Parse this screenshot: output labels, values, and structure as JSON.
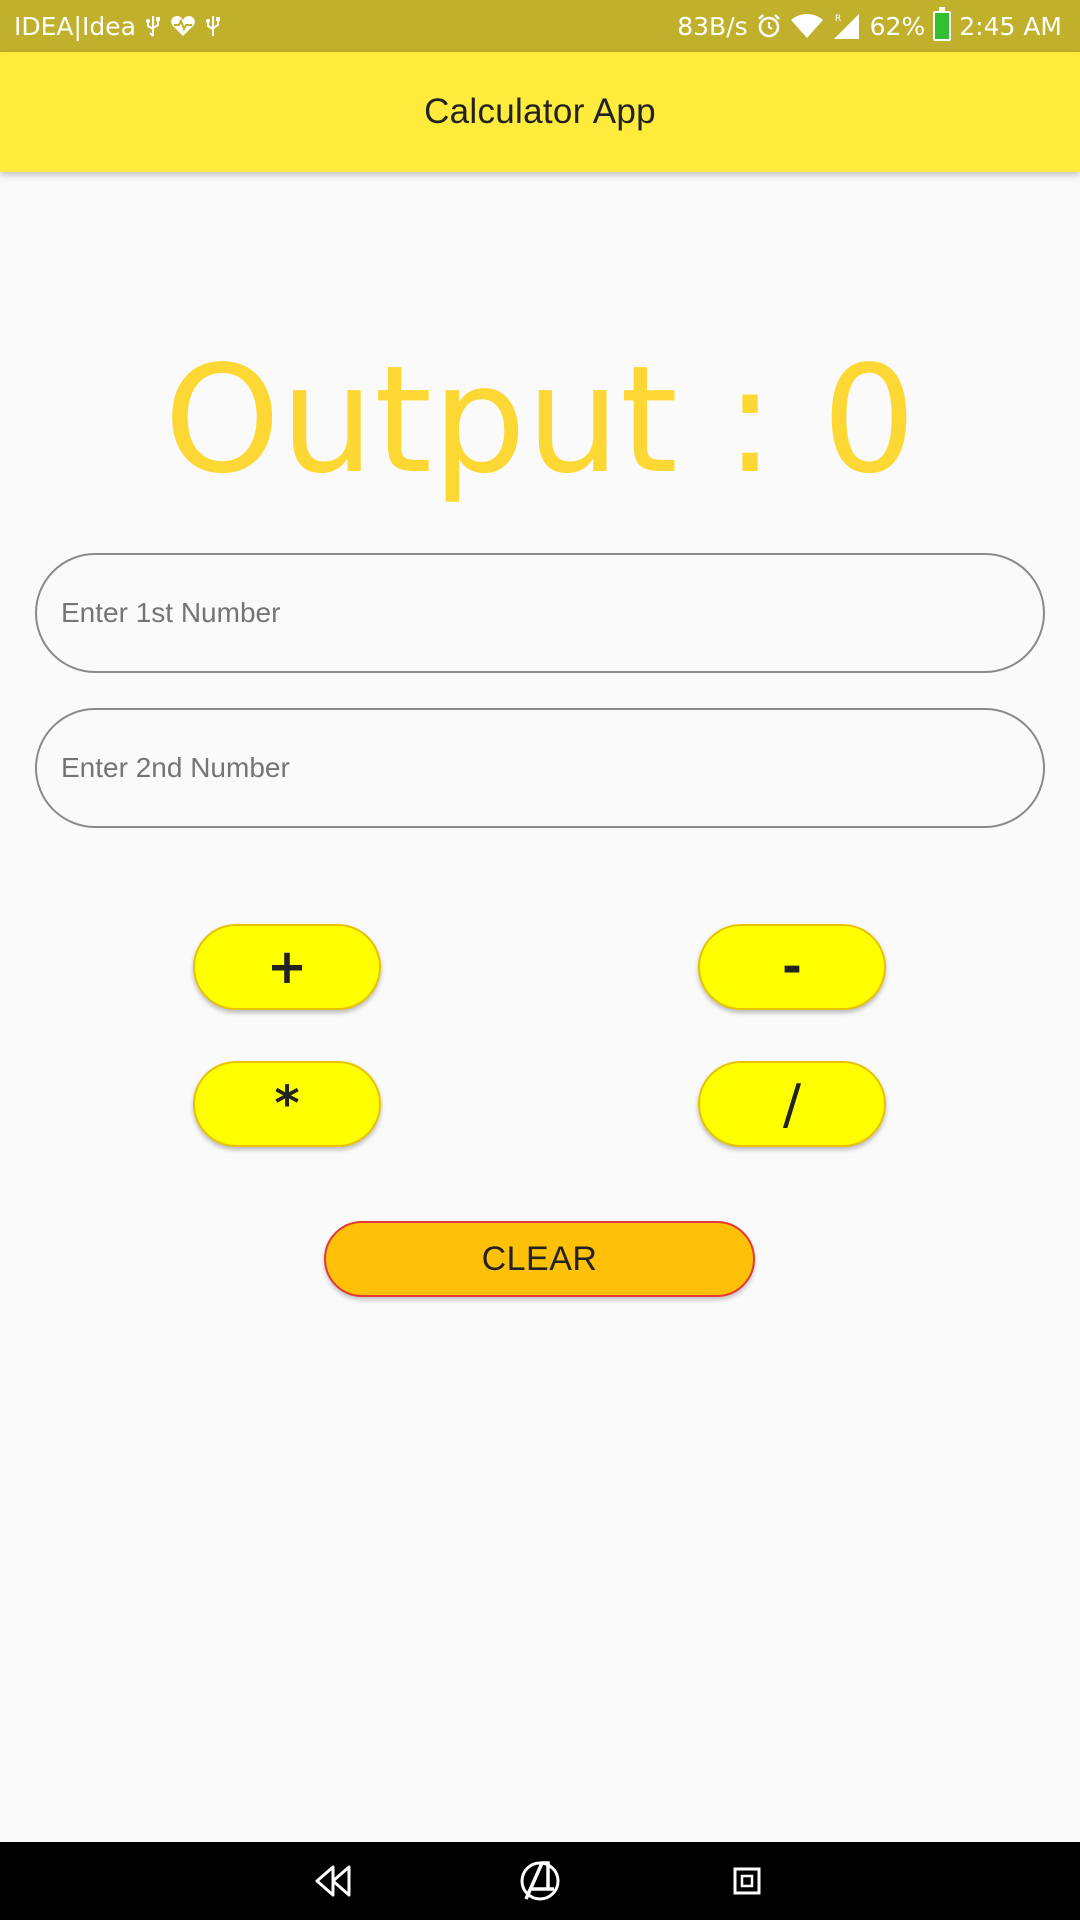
{
  "status_bar": {
    "carrier": "IDEA|Idea",
    "net_speed": "83B/s",
    "battery_percent": "62%",
    "time": "2:45 AM",
    "icons": [
      "usb-icon",
      "health-icon",
      "usb-icon",
      "alarm-icon",
      "wifi-icon",
      "signal-icon",
      "battery-icon"
    ]
  },
  "app_bar": {
    "title": "Calculator App"
  },
  "output": {
    "text": "Output : 0"
  },
  "inputs": {
    "first_placeholder": "Enter 1st Number",
    "second_placeholder": "Enter 2nd Number"
  },
  "buttons": {
    "add": "+",
    "subtract": "-",
    "multiply": "*",
    "divide": "/",
    "clear": "CLEAR"
  },
  "nav_bar": {
    "icons": [
      "back-icon",
      "home-icon",
      "recents-icon"
    ]
  },
  "colors": {
    "status_bar": "#c0b02c",
    "app_bar": "#ffeb3b",
    "output_text": "#fdd835",
    "operator_button": "#ffff00",
    "clear_button": "#ffc107",
    "clear_border": "#e53935"
  }
}
